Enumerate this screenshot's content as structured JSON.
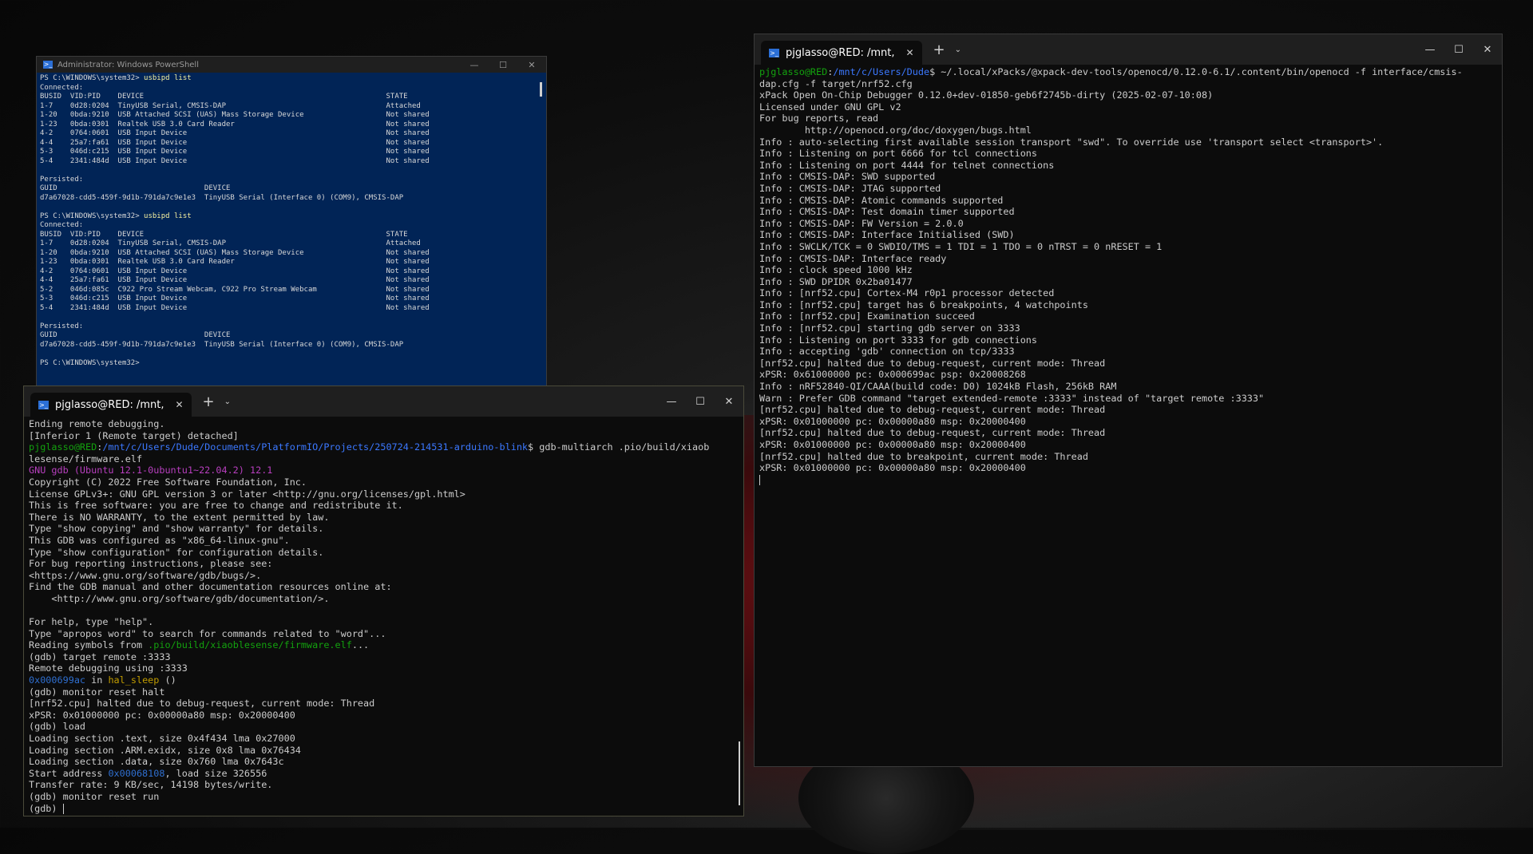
{
  "powershell": {
    "title": "Administrator: Windows PowerShell",
    "controls": {
      "minimize": "—",
      "maximize": "☐",
      "close": "✕"
    },
    "lines": [
      {
        "t": "PS C:\\WINDOWS\\system32> ",
        "c": "usbipd list"
      },
      {
        "t": "Connected:"
      },
      {
        "t": "BUSID  VID:PID    DEVICE                                                        STATE"
      },
      {
        "t": "1-7    0d28:0204  TinyUSB Serial, CMSIS-DAP                                     Attached"
      },
      {
        "t": "1-20   0bda:9210  USB Attached SCSI (UAS) Mass Storage Device                   Not shared"
      },
      {
        "t": "1-23   0bda:0301  Realtek USB 3.0 Card Reader                                   Not shared"
      },
      {
        "t": "4-2    0764:0601  USB Input Device                                              Not shared"
      },
      {
        "t": "4-4    25a7:fa61  USB Input Device                                              Not shared"
      },
      {
        "t": "5-3    046d:c215  USB Input Device                                              Not shared"
      },
      {
        "t": "5-4    2341:484d  USB Input Device                                              Not shared"
      },
      {
        "t": ""
      },
      {
        "t": "Persisted:"
      },
      {
        "t": "GUID                                  DEVICE"
      },
      {
        "t": "d7a67028-cdd5-459f-9d1b-791da7c9e1e3  TinyUSB Serial (Interface 0) (COM9), CMSIS-DAP"
      },
      {
        "t": ""
      },
      {
        "t": "PS C:\\WINDOWS\\system32> ",
        "c": "usbipd list"
      },
      {
        "t": "Connected:"
      },
      {
        "t": "BUSID  VID:PID    DEVICE                                                        STATE"
      },
      {
        "t": "1-7    0d28:0204  TinyUSB Serial, CMSIS-DAP                                     Attached"
      },
      {
        "t": "1-20   0bda:9210  USB Attached SCSI (UAS) Mass Storage Device                   Not shared"
      },
      {
        "t": "1-23   0bda:0301  Realtek USB 3.0 Card Reader                                   Not shared"
      },
      {
        "t": "4-2    0764:0601  USB Input Device                                              Not shared"
      },
      {
        "t": "4-4    25a7:fa61  USB Input Device                                              Not shared"
      },
      {
        "t": "5-2    046d:085c  C922 Pro Stream Webcam, C922 Pro Stream Webcam                Not shared"
      },
      {
        "t": "5-3    046d:c215  USB Input Device                                              Not shared"
      },
      {
        "t": "5-4    2341:484d  USB Input Device                                              Not shared"
      },
      {
        "t": ""
      },
      {
        "t": "Persisted:"
      },
      {
        "t": "GUID                                  DEVICE"
      },
      {
        "t": "d7a67028-cdd5-459f-9d1b-791da7c9e1e3  TinyUSB Serial (Interface 0) (COM9), CMSIS-DAP"
      },
      {
        "t": ""
      },
      {
        "t": "PS C:\\WINDOWS\\system32>"
      }
    ]
  },
  "terminal_right": {
    "tab_title": "pjglasso@RED: /mnt,",
    "new_tab": "+",
    "dropdown": "⌄",
    "controls": {
      "minimize": "—",
      "maximize": "☐",
      "close": "✕"
    },
    "lines": [
      [
        {
          "t": "pjglasso@RED",
          "s": "green"
        },
        {
          "t": ":"
        },
        {
          "t": "/mnt/c/Users/Dude",
          "s": "blue"
        },
        {
          "t": "$ ~/.local/xPacks/@xpack-dev-tools/openocd/0.12.0-6.1/.content/bin/openocd -f interface/cmsis-"
        }
      ],
      [
        {
          "t": "dap.cfg -f target/nrf52.cfg"
        }
      ],
      [
        {
          "t": "xPack Open On-Chip Debugger 0.12.0+dev-01850-geb6f2745b-dirty (2025-02-07-10:08)"
        }
      ],
      [
        {
          "t": "Licensed under GNU GPL v2"
        }
      ],
      [
        {
          "t": "For bug reports, read"
        }
      ],
      [
        {
          "t": "        http://openocd.org/doc/doxygen/bugs.html"
        }
      ],
      [
        {
          "t": "Info : auto-selecting first available session transport \"swd\". To override use 'transport select <transport>'."
        }
      ],
      [
        {
          "t": "Info : Listening on port 6666 for tcl connections"
        }
      ],
      [
        {
          "t": "Info : Listening on port 4444 for telnet connections"
        }
      ],
      [
        {
          "t": "Info : CMSIS-DAP: SWD supported"
        }
      ],
      [
        {
          "t": "Info : CMSIS-DAP: JTAG supported"
        }
      ],
      [
        {
          "t": "Info : CMSIS-DAP: Atomic commands supported"
        }
      ],
      [
        {
          "t": "Info : CMSIS-DAP: Test domain timer supported"
        }
      ],
      [
        {
          "t": "Info : CMSIS-DAP: FW Version = 2.0.0"
        }
      ],
      [
        {
          "t": "Info : CMSIS-DAP: Interface Initialised (SWD)"
        }
      ],
      [
        {
          "t": "Info : SWCLK/TCK = 0 SWDIO/TMS = 1 TDI = 1 TDO = 0 nTRST = 0 nRESET = 1"
        }
      ],
      [
        {
          "t": "Info : CMSIS-DAP: Interface ready"
        }
      ],
      [
        {
          "t": "Info : clock speed 1000 kHz"
        }
      ],
      [
        {
          "t": "Info : SWD DPIDR 0x2ba01477"
        }
      ],
      [
        {
          "t": "Info : [nrf52.cpu] Cortex-M4 r0p1 processor detected"
        }
      ],
      [
        {
          "t": "Info : [nrf52.cpu] target has 6 breakpoints, 4 watchpoints"
        }
      ],
      [
        {
          "t": "Info : [nrf52.cpu] Examination succeed"
        }
      ],
      [
        {
          "t": "Info : [nrf52.cpu] starting gdb server on 3333"
        }
      ],
      [
        {
          "t": "Info : Listening on port 3333 for gdb connections"
        }
      ],
      [
        {
          "t": "Info : accepting 'gdb' connection on tcp/3333"
        }
      ],
      [
        {
          "t": "[nrf52.cpu] halted due to debug-request, current mode: Thread"
        }
      ],
      [
        {
          "t": "xPSR: 0x61000000 pc: 0x000699ac psp: 0x20008268"
        }
      ],
      [
        {
          "t": "Info : nRF52840-QI/CAAA(build code: D0) 1024kB Flash, 256kB RAM"
        }
      ],
      [
        {
          "t": "Warn : Prefer GDB command \"target extended-remote :3333\" instead of \"target remote :3333\""
        }
      ],
      [
        {
          "t": "[nrf52.cpu] halted due to debug-request, current mode: Thread"
        }
      ],
      [
        {
          "t": "xPSR: 0x01000000 pc: 0x00000a80 msp: 0x20000400"
        }
      ],
      [
        {
          "t": "[nrf52.cpu] halted due to debug-request, current mode: Thread"
        }
      ],
      [
        {
          "t": "xPSR: 0x01000000 pc: 0x00000a80 msp: 0x20000400"
        }
      ],
      [
        {
          "t": "[nrf52.cpu] halted due to breakpoint, current mode: Thread"
        }
      ],
      [
        {
          "t": "xPSR: 0x01000000 pc: 0x00000a80 msp: 0x20000400"
        }
      ]
    ]
  },
  "terminal_left": {
    "tab_title": "pjglasso@RED: /mnt,",
    "new_tab": "+",
    "dropdown": "⌄",
    "controls": {
      "minimize": "—",
      "maximize": "☐",
      "close": "✕"
    },
    "lines": [
      [
        {
          "t": "Ending remote debugging."
        }
      ],
      [
        {
          "t": "[Inferior 1 (Remote target) detached]"
        }
      ],
      [
        {
          "t": "pjglasso@RED",
          "s": "green"
        },
        {
          "t": ":"
        },
        {
          "t": "/mnt/c/Users/Dude/Documents/PlatformIO/Projects/250724-214531-arduino-blink",
          "s": "blue"
        },
        {
          "t": "$ gdb-multiarch .pio/build/xiaob"
        }
      ],
      [
        {
          "t": "lesense/firmware.elf"
        }
      ],
      [
        {
          "t": "GNU gdb (Ubuntu 12.1-0ubuntu1~22.04.2) 12.1",
          "s": "magenta"
        }
      ],
      [
        {
          "t": "Copyright (C) 2022 Free Software Foundation, Inc."
        }
      ],
      [
        {
          "t": "License GPLv3+: GNU GPL version 3 or later <http://gnu.org/licenses/gpl.html>"
        }
      ],
      [
        {
          "t": "This is free software: you are free to change and redistribute it."
        }
      ],
      [
        {
          "t": "There is NO WARRANTY, to the extent permitted by law."
        }
      ],
      [
        {
          "t": "Type \"show copying\" and \"show warranty\" for details."
        }
      ],
      [
        {
          "t": "This GDB was configured as \"x86_64-linux-gnu\"."
        }
      ],
      [
        {
          "t": "Type \"show configuration\" for configuration details."
        }
      ],
      [
        {
          "t": "For bug reporting instructions, please see:"
        }
      ],
      [
        {
          "t": "<https://www.gnu.org/software/gdb/bugs/>."
        }
      ],
      [
        {
          "t": "Find the GDB manual and other documentation resources online at:"
        }
      ],
      [
        {
          "t": "    <http://www.gnu.org/software/gdb/documentation/>."
        }
      ],
      [
        {
          "t": ""
        }
      ],
      [
        {
          "t": "For help, type \"help\"."
        }
      ],
      [
        {
          "t": "Type \"apropos word\" to search for commands related to \"word\"..."
        }
      ],
      [
        {
          "t": "Reading symbols from "
        },
        {
          "t": ".pio/build/xiaoblesense/firmware.elf",
          "s": "green"
        },
        {
          "t": "..."
        }
      ],
      [
        {
          "t": "(gdb) target remote :3333"
        }
      ],
      [
        {
          "t": "Remote debugging using :3333"
        }
      ],
      [
        {
          "t": "0x000699ac",
          "s": "cyanish"
        },
        {
          "t": " in "
        },
        {
          "t": "hal_sleep",
          "s": "yellow"
        },
        {
          "t": " ()"
        }
      ],
      [
        {
          "t": "(gdb) monitor reset halt"
        }
      ],
      [
        {
          "t": "[nrf52.cpu] halted due to debug-request, current mode: Thread"
        }
      ],
      [
        {
          "t": "xPSR: 0x01000000 pc: 0x00000a80 msp: 0x20000400"
        }
      ],
      [
        {
          "t": "(gdb) load"
        }
      ],
      [
        {
          "t": "Loading section .text, size 0x4f434 lma 0x27000"
        }
      ],
      [
        {
          "t": "Loading section .ARM.exidx, size 0x8 lma 0x76434"
        }
      ],
      [
        {
          "t": "Loading section .data, size 0x760 lma 0x7643c"
        }
      ],
      [
        {
          "t": "Start address "
        },
        {
          "t": "0x00068108",
          "s": "cyanish"
        },
        {
          "t": ", load size 326556"
        }
      ],
      [
        {
          "t": "Transfer rate: 9 KB/sec, 14198 bytes/write."
        }
      ],
      [
        {
          "t": "(gdb) monitor reset run"
        }
      ],
      [
        {
          "t": "(gdb) "
        }
      ]
    ]
  }
}
